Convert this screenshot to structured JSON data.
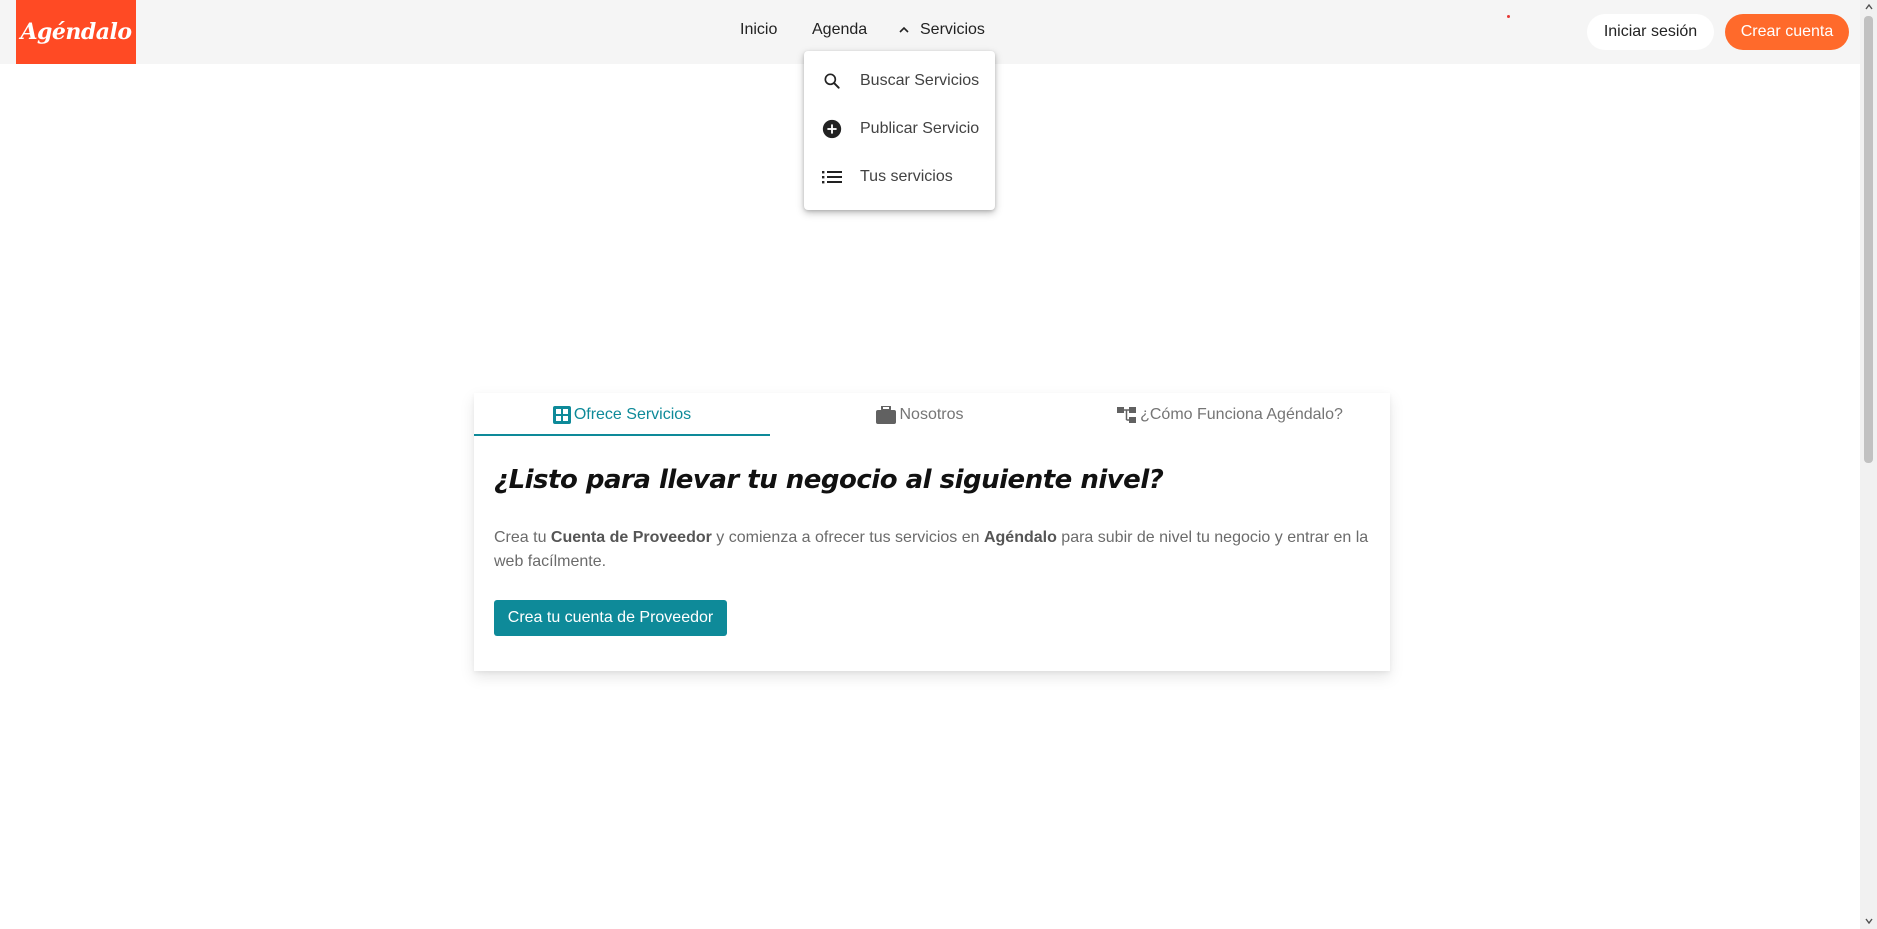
{
  "header": {
    "logo_text": "Agéndalo",
    "nav": {
      "inicio": "Inicio",
      "agenda": "Agenda",
      "servicios": "Servicios"
    },
    "login_label": "Iniciar sesión",
    "signup_label": "Crear cuenta"
  },
  "servicios_menu": {
    "items": [
      {
        "label": "Buscar Servicios",
        "icon": "search-icon"
      },
      {
        "label": "Publicar Servicio",
        "icon": "add-circle-icon"
      },
      {
        "label": "Tus servicios",
        "icon": "list-icon"
      }
    ]
  },
  "card": {
    "tabs": [
      {
        "label": "Ofrece Servicios",
        "icon": "grid-icon",
        "active": true
      },
      {
        "label": "Nosotros",
        "icon": "briefcase-icon",
        "active": false
      },
      {
        "label": "¿Cómo Funciona Agéndalo?",
        "icon": "sitemap-icon",
        "active": false
      }
    ],
    "title": "¿Listo para llevar tu negocio al siguiente nivel?",
    "text": {
      "part1": "Crea tu ",
      "bold1": "Cuenta de Proveedor",
      "part2": " y comienza a ofrecer tus servicios en ",
      "bold2": "Agéndalo",
      "part3": " para subir de nivel tu negocio y entrar en la web facílmente."
    },
    "cta_label": "Crea tu cuenta de Proveedor"
  },
  "colors": {
    "brand_red": "#ff4a24",
    "signup_orange": "#ff6a2b",
    "teal": "#0e8a99",
    "header_bg": "#f5f5f5"
  }
}
